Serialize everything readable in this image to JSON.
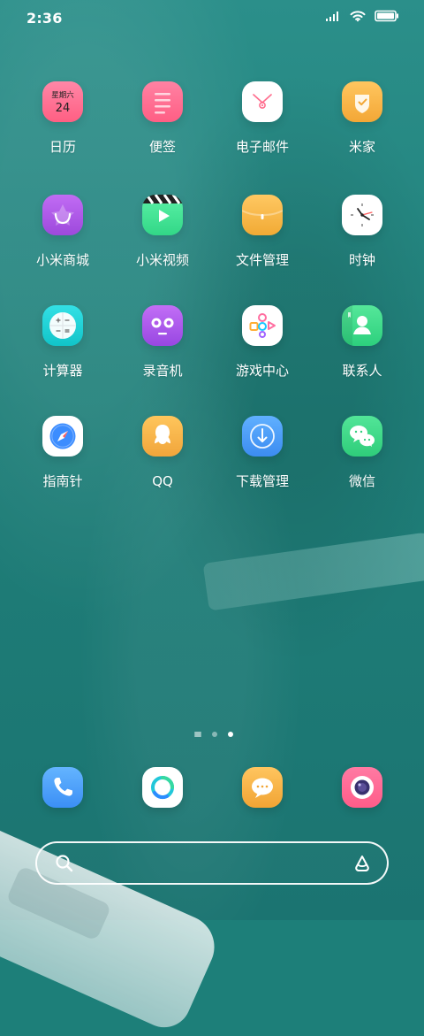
{
  "status_bar": {
    "time": "2:36",
    "signal_icon": "signal-icon",
    "wifi_icon": "wifi-icon",
    "battery_icon": "battery-icon"
  },
  "calendar": {
    "weekday": "星期六",
    "date": "24"
  },
  "apps": [
    {
      "label": "日历",
      "icon": "calendar-icon",
      "color": "#ff6f8f"
    },
    {
      "label": "便签",
      "icon": "notes-icon",
      "color": "#ff7096"
    },
    {
      "label": "电子邮件",
      "icon": "email-icon",
      "color": "#ffffff"
    },
    {
      "label": "米家",
      "icon": "mijia-icon",
      "color": "#f9b447"
    },
    {
      "label": "小米商城",
      "icon": "mi-store-icon",
      "color": "#b255e8"
    },
    {
      "label": "小米视频",
      "icon": "mi-video-icon",
      "color": "#4ee59b"
    },
    {
      "label": "文件管理",
      "icon": "file-manager-icon",
      "color": "#f7b53e"
    },
    {
      "label": "时钟",
      "icon": "clock-icon",
      "color": "#ffffff"
    },
    {
      "label": "计算器",
      "icon": "calculator-icon",
      "color": "#2ad7d9"
    },
    {
      "label": "录音机",
      "icon": "recorder-icon",
      "color": "#b45df4"
    },
    {
      "label": "游戏中心",
      "icon": "game-center-icon",
      "color": "#ffffff"
    },
    {
      "label": "联系人",
      "icon": "contacts-icon",
      "color": "#49d98f"
    },
    {
      "label": "指南针",
      "icon": "compass-icon",
      "color": "#ffffff"
    },
    {
      "label": "QQ",
      "icon": "qq-icon",
      "color": "#f8b44d"
    },
    {
      "label": "下载管理",
      "icon": "download-manager-icon",
      "color": "#4ea4ff"
    },
    {
      "label": "微信",
      "icon": "wechat-icon",
      "color": "#47dc8a"
    }
  ],
  "page_indicator": {
    "page_count": 2,
    "active_page": 2
  },
  "dock": [
    {
      "icon": "phone-icon",
      "color": "#4d9dff"
    },
    {
      "icon": "browser-icon",
      "color": "#ffffff"
    },
    {
      "icon": "message-icon",
      "color": "#f6b248"
    },
    {
      "icon": "camera-icon",
      "color": "#ff6f98"
    }
  ],
  "search": {
    "placeholder": "",
    "left_icon": "search-icon",
    "right_icon": "assistant-icon"
  }
}
